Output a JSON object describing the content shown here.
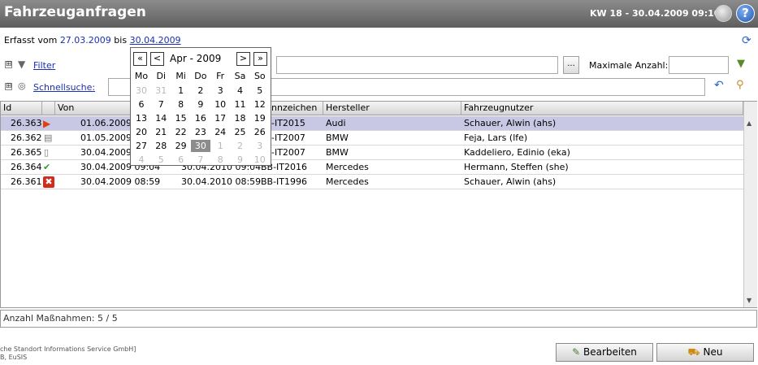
{
  "header": {
    "title": "Fahrzeuganfragen",
    "week": "KW 18 - 30.04.2009 09:10",
    "help_glyph": "?"
  },
  "daterange": {
    "prefix": "Erfasst vom",
    "from": "27.03.2009",
    "mid": "bis",
    "to": "30.04.2009"
  },
  "filter": {
    "plus": "⊞",
    "label": "Filter",
    "more_button": "...",
    "max_label": "Maximale Anzahl:",
    "max_value": ""
  },
  "quicksearch": {
    "plus": "⊞",
    "label": "Schnellsuche:",
    "value": ""
  },
  "table": {
    "columns": [
      "Id",
      "",
      "Von",
      "",
      "Kennzeichen",
      "Hersteller",
      "Fahrzeugnutzer"
    ],
    "col_visible": {
      "id": "Id",
      "von": "Von",
      "kennz": "nnzeichen",
      "herst": "Hersteller",
      "nutzer": "Fahrzeugnutzer"
    },
    "rows": [
      {
        "id": "26.363",
        "icon": "play-icon",
        "von": "01.06.2009",
        "bis": "",
        "kennz": "BB-IT2015",
        "herst": "Audi",
        "nutzer": "Schauer, Alwin (ahs)",
        "selected": true
      },
      {
        "id": "26.362",
        "icon": "document-lines-icon",
        "von": "01.05.2009",
        "bis": "",
        "kennz": "BB-IT2007",
        "herst": "BMW",
        "nutzer": "Feja, Lars (lfe)",
        "selected": false
      },
      {
        "id": "26.365",
        "icon": "document-icon",
        "von": "30.04.2009",
        "bis": "",
        "kennz": "BB-IT2007",
        "herst": "BMW",
        "nutzer": "Kaddeliero, Edinio (eka)",
        "selected": false
      },
      {
        "id": "26.364",
        "icon": "check-icon",
        "von": "30.04.2009 09:04",
        "bis": "30.04.2010 09:04",
        "kennz": "BB-IT2016",
        "herst": "Mercedes",
        "nutzer": "Hermann, Steffen  (she)",
        "selected": false
      },
      {
        "id": "26.361",
        "icon": "cross-icon",
        "von": "30.04.2009 08:59",
        "bis": "30.04.2010 08:59",
        "kennz": "BB-IT1996",
        "herst": "Mercedes",
        "nutzer": "Schauer, Alwin (ahs)",
        "selected": false
      }
    ],
    "visible_prefixes": [
      "-IT2015",
      "-IT2007",
      "-IT2007",
      "BB-IT2016",
      "BB-IT1996"
    ]
  },
  "count": "Anzahl Maßnahmen: 5 / 5",
  "footer": {
    "line1": "che Standort Informations Service GmbH]",
    "line2": "B, EuSIS"
  },
  "buttons": {
    "edit": "Bearbeiten",
    "new": "Neu"
  },
  "calendar": {
    "nav_prev_year": "«",
    "nav_prev": "<",
    "month": "Apr - 2009",
    "nav_next": ">",
    "nav_next_year": "»",
    "weekdays": [
      "Mo",
      "Di",
      "Mi",
      "Do",
      "Fr",
      "Sa",
      "So"
    ],
    "weeks": [
      [
        "30",
        "31",
        "1",
        "2",
        "3",
        "4",
        "5"
      ],
      [
        "6",
        "7",
        "8",
        "9",
        "10",
        "11",
        "12"
      ],
      [
        "13",
        "14",
        "15",
        "16",
        "17",
        "18",
        "19"
      ],
      [
        "20",
        "21",
        "22",
        "23",
        "24",
        "25",
        "26"
      ],
      [
        "27",
        "28",
        "29",
        "30",
        "1",
        "2",
        "3"
      ],
      [
        "4",
        "5",
        "6",
        "7",
        "8",
        "9",
        "10"
      ]
    ],
    "selected_day": "30"
  },
  "colors": {
    "header_bg": "#6f6f6f",
    "link": "#1a2fb4",
    "selected_row": "#c8c8e4"
  }
}
